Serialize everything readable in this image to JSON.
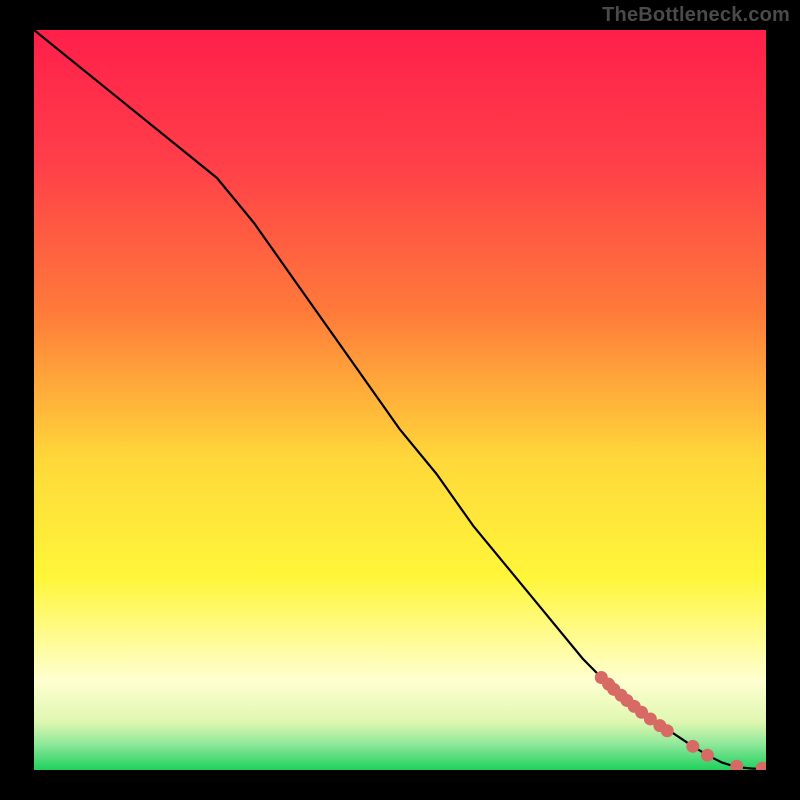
{
  "watermark": "TheBottleneck.com",
  "colors": {
    "gradient_top": "#ff1f4a",
    "gradient_mid1": "#ff7a3a",
    "gradient_mid2": "#ffd83a",
    "gradient_mid3": "#fff63a",
    "gradient_low": "#ffffd0",
    "gradient_bottom": "#1fd15e",
    "line": "#000000",
    "marker": "#d86a66",
    "frame": "#000000"
  },
  "chart_data": {
    "type": "line",
    "title": "",
    "xlabel": "",
    "ylabel": "",
    "xlim": [
      0,
      100
    ],
    "ylim": [
      0,
      100
    ],
    "series": [
      {
        "name": "curve",
        "x": [
          0,
          5,
          10,
          15,
          20,
          25,
          30,
          35,
          40,
          45,
          50,
          55,
          60,
          65,
          70,
          75,
          80,
          85,
          90,
          92,
          94,
          96,
          98,
          100
        ],
        "y": [
          100,
          96,
          92,
          88,
          84,
          80,
          74,
          67,
          60,
          53,
          46,
          40,
          33,
          27,
          21,
          15,
          10,
          6.5,
          3.2,
          2.0,
          1.0,
          0.4,
          0.2,
          0.1
        ]
      }
    ],
    "markers": {
      "name": "cluster",
      "x": [
        77.5,
        78.5,
        79.2,
        80.2,
        81.0,
        82.0,
        83.0,
        84.2,
        85.5,
        86.5,
        90.0,
        92.0,
        96.0,
        99.5
      ],
      "y": [
        12.5,
        11.6,
        10.9,
        10.1,
        9.4,
        8.6,
        7.8,
        6.9,
        6.0,
        5.3,
        3.2,
        2.0,
        0.5,
        0.25
      ]
    }
  }
}
